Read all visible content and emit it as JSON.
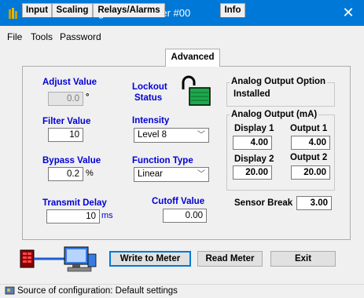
{
  "window": {
    "title": "MeterView Configuration - Meter #00",
    "close_glyph": "✕"
  },
  "menu": [
    "File",
    "Tools",
    "Password"
  ],
  "tabs": [
    "Input",
    "Scaling",
    "Relays/Alarms",
    "Advanced",
    "Info"
  ],
  "active_tab": "Advanced",
  "advanced": {
    "adjust_value": {
      "label": "Adjust Value",
      "value": "0.0",
      "unit": "°"
    },
    "filter_value": {
      "label": "Filter Value",
      "value": "10"
    },
    "bypass_value": {
      "label": "Bypass Value",
      "value": "0.2",
      "unit": "%"
    },
    "transmit_delay": {
      "label": "Transmit Delay",
      "value": "10",
      "unit": "ms"
    },
    "lockout_status": {
      "label_line1": "Lockout",
      "label_line2": "Status",
      "icon": "unlocked-padlock-icon"
    },
    "intensity": {
      "label": "Intensity",
      "selected": "Level 8"
    },
    "function_type": {
      "label": "Function Type",
      "selected": "Linear"
    },
    "cutoff_value": {
      "label": "Cutoff Value",
      "value": "0.00"
    },
    "analog_option": {
      "title": "Analog Output Option",
      "value": "Installed"
    },
    "analog_output": {
      "title": "Analog Output (mA)",
      "display1_label": "Display 1",
      "display1_value": "4.00",
      "output1_label": "Output 1",
      "output1_value": "4.00",
      "display2_label": "Display 2",
      "display2_value": "20.00",
      "output2_label": "Output 2",
      "output2_value": "20.00"
    },
    "sensor_break": {
      "label": "Sensor Break",
      "value": "3.00"
    }
  },
  "buttons": {
    "write": "Write to Meter",
    "read": "Read Meter",
    "exit": "Exit"
  },
  "status": {
    "text": "Source of configuration: Default settings"
  },
  "colors": {
    "titlebar": "#0078d7",
    "label_blue": "#0000d4",
    "lock_green": "#1ea84a"
  }
}
